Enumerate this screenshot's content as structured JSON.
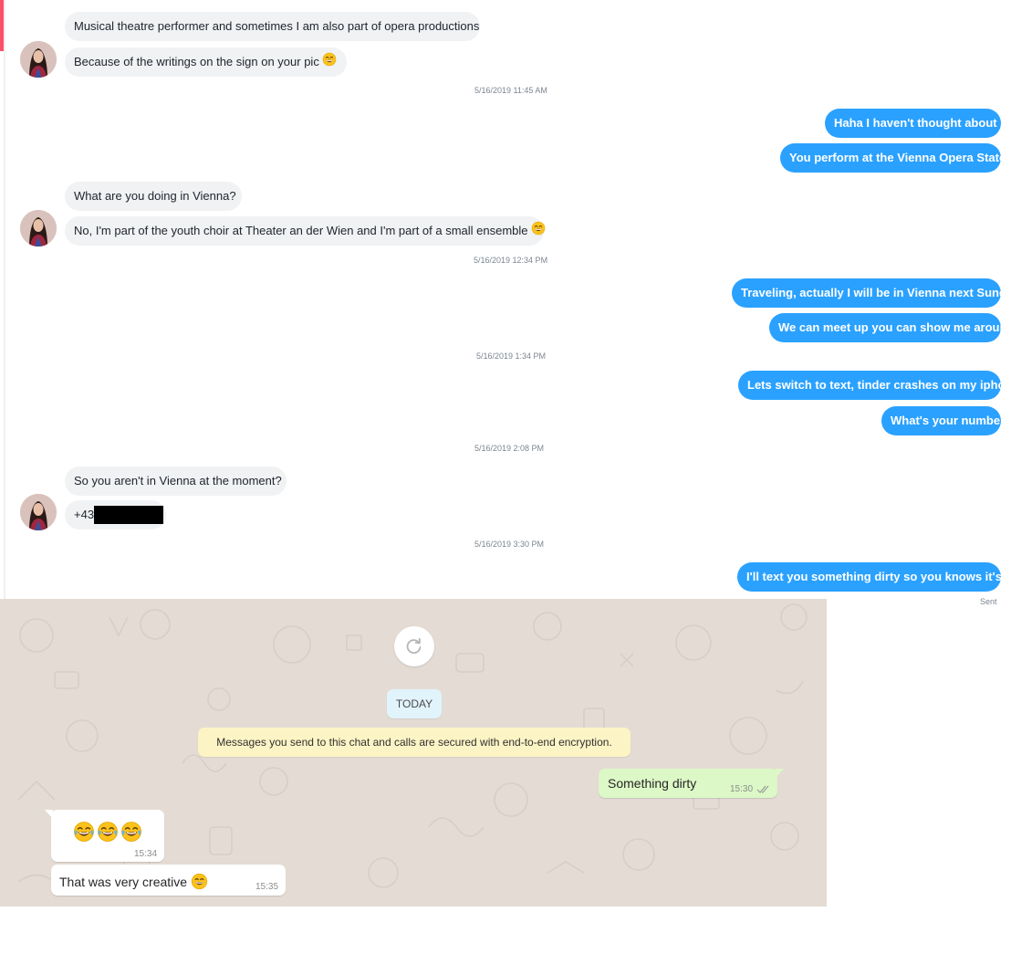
{
  "tinder": {
    "messages": [
      {
        "side": "received",
        "text": "Musical theatre performer and sometimes I am also part of opera productions"
      },
      {
        "side": "received",
        "text": "Because of the writings on the sign on your pic",
        "emoji": "😄"
      },
      {
        "side": "received",
        "text": "What are you doing in Vienna?"
      },
      {
        "side": "received",
        "text": "No, I'm part of the youth choir at Theater an der Wien and I'm part of a small ensemble",
        "emoji": "🙂"
      },
      {
        "side": "received",
        "text": "So you aren't in Vienna at the moment?"
      },
      {
        "side": "received",
        "text": "+43",
        "redacted": true
      },
      {
        "side": "sent",
        "text": "Haha I haven't thought about it"
      },
      {
        "side": "sent",
        "text": "You perform at the Vienna Opera State?"
      },
      {
        "side": "sent",
        "text": "Traveling, actually I will be in Vienna next Sunday"
      },
      {
        "side": "sent",
        "text": "We can meet up you can show me around"
      },
      {
        "side": "sent",
        "text": "Lets switch to text, tinder crashes on my iphone"
      },
      {
        "side": "sent",
        "text": "What's your number"
      },
      {
        "side": "sent",
        "text": "I'll text you something dirty so you knows it's me"
      }
    ],
    "timestamps": [
      "5/16/2019 11:45 AM",
      "5/16/2019 12:34 PM",
      "5/16/2019 1:34 PM",
      "5/16/2019 2:08 PM",
      "5/16/2019 3:30 PM"
    ],
    "status": "Sent",
    "colors": {
      "sent_bubble": "#2aa1ff",
      "received_bubble": "#f0f2f4",
      "accent": "#fd5068"
    }
  },
  "whatsapp": {
    "refresh_icon": "refresh-icon",
    "date_badge": "TODAY",
    "encryption_notice": "Messages you send to this chat and calls are secured with end-to-end encryption.",
    "messages": [
      {
        "side": "outgoing",
        "text": "Something dirty",
        "time": "15:30",
        "status_icon": "double-check-icon"
      },
      {
        "side": "incoming",
        "emoji": "😂😂😂",
        "time": "15:34"
      },
      {
        "side": "incoming",
        "text": "That was very creative",
        "emoji": "😄",
        "time": "15:35"
      }
    ],
    "colors": {
      "background": "#e4dcd4",
      "outgoing_bubble": "#dcf8c6",
      "incoming_bubble": "#ffffff",
      "date_badge": "#e1f3fb",
      "notice": "#fdf4c5"
    }
  }
}
